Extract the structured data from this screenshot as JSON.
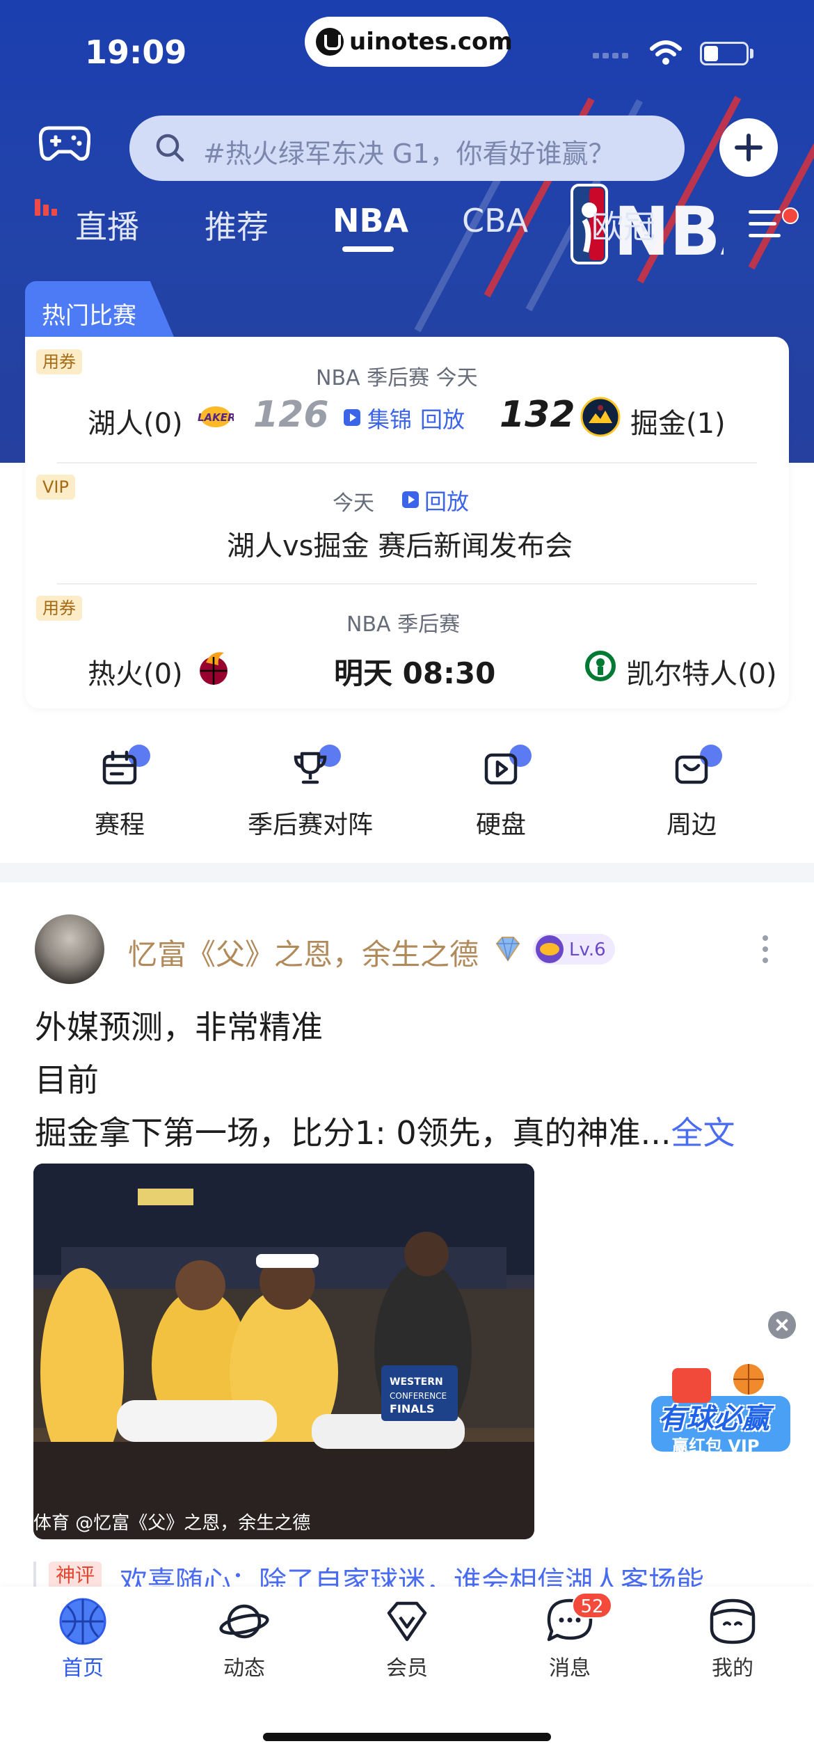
{
  "status_bar": {
    "time": "19:09",
    "url": "uinotes.com"
  },
  "search": {
    "placeholder": "#热火绿军东决 G1，你看好谁赢？"
  },
  "tabs": [
    {
      "label": "直播"
    },
    {
      "label": "推荐"
    },
    {
      "label": "NBA",
      "active": true
    },
    {
      "label": "CBA"
    },
    {
      "label": "欧冠"
    }
  ],
  "hot_games": {
    "label": "热门比赛",
    "games": [
      {
        "tag": "用券",
        "meta": "NBA 季后赛  今天",
        "home": "湖人(0)",
        "home_score": "126",
        "highlights": "集锦",
        "replay": "回放",
        "away_score": "132",
        "away": "掘金(1)"
      },
      {
        "tag": "VIP",
        "meta": "今天",
        "replay": "回放",
        "title": "湖人vs掘金 赛后新闻发布会"
      },
      {
        "tag": "用券",
        "meta": "NBA 季后赛",
        "home": "热火(0)",
        "time": "明天 08:30",
        "away": "凯尔特人(0)"
      }
    ]
  },
  "quick_menu": [
    {
      "label": "赛程",
      "icon": "calendar-icon"
    },
    {
      "label": "季后赛对阵",
      "icon": "trophy-icon"
    },
    {
      "label": "硬盘",
      "icon": "video-icon"
    },
    {
      "label": "周边",
      "icon": "bag-icon"
    }
  ],
  "post": {
    "username": "忆富《父》之恩，余生之德",
    "level": "Lv.6",
    "lines": [
      "外媒预测，非常精准",
      "目前",
      "掘金拿下第一场，比分1: 0领先，真的神准..."
    ],
    "full_text": "全文",
    "image_caption": "体育 @忆富《父》之恩，余生之德",
    "comment_tag": "神评",
    "comment_text": "欢喜随心：除了自家球迷，谁会相信湖人客场能"
  },
  "ad": {
    "line1": "有球必赢",
    "line2": "赢红包 VIP"
  },
  "bottom_nav": [
    {
      "label": "首页",
      "icon": "basketball-icon",
      "active": true
    },
    {
      "label": "动态",
      "icon": "planet-icon"
    },
    {
      "label": "会员",
      "icon": "diamond-icon"
    },
    {
      "label": "消息",
      "icon": "message-icon",
      "badge": "52"
    },
    {
      "label": "我的",
      "icon": "profile-icon"
    }
  ],
  "colors": {
    "brand_blue": "#2243a8",
    "accent": "#3b64e8",
    "badge_red": "#f44a3c"
  }
}
